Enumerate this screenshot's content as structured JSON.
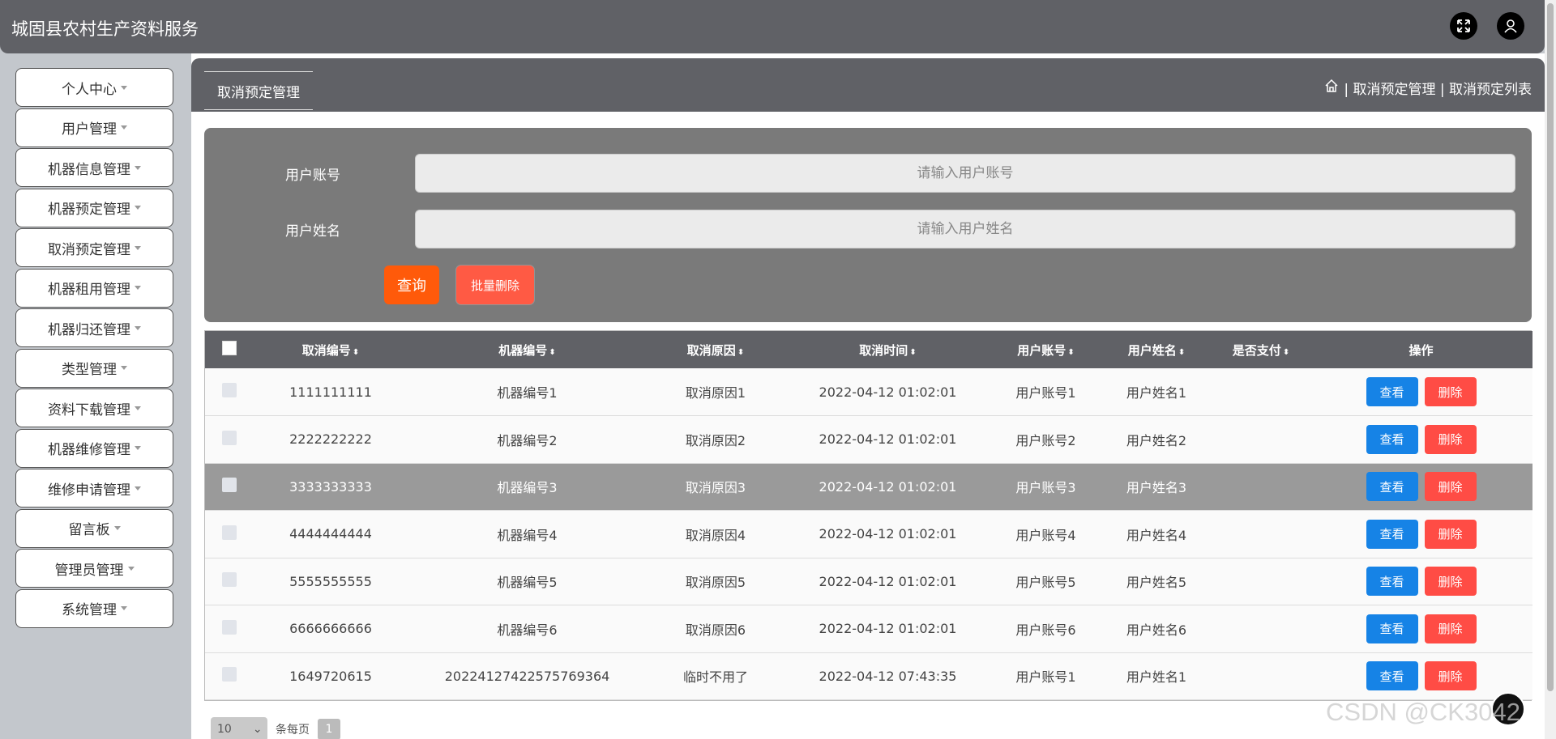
{
  "header": {
    "title": "城固县农村生产资料服务",
    "icons": [
      "fullscreen-icon",
      "user-icon"
    ]
  },
  "sidebar": {
    "items": [
      {
        "label": "个人中心"
      },
      {
        "label": "用户管理"
      },
      {
        "label": "机器信息管理"
      },
      {
        "label": "机器预定管理"
      },
      {
        "label": "取消预定管理"
      },
      {
        "label": "机器租用管理"
      },
      {
        "label": "机器归还管理"
      },
      {
        "label": "类型管理"
      },
      {
        "label": "资料下载管理"
      },
      {
        "label": "机器维修管理"
      },
      {
        "label": "维修申请管理"
      },
      {
        "label": "留言板"
      },
      {
        "label": "管理员管理"
      },
      {
        "label": "系统管理"
      }
    ]
  },
  "breadcrumb": {
    "page_title": "取消预定管理",
    "path": "| 取消预定管理 | 取消预定列表"
  },
  "search": {
    "account_label": "用户账号",
    "account_placeholder": "请输入用户账号",
    "name_label": "用户姓名",
    "name_placeholder": "请输入用户姓名",
    "query_label": "查询",
    "batch_delete_label": "批量删除"
  },
  "table": {
    "columns": [
      "取消编号",
      "机器编号",
      "取消原因",
      "取消时间",
      "用户账号",
      "用户姓名",
      "是否支付",
      "操作"
    ],
    "rows": [
      {
        "id": "1111111111",
        "machine": "机器编号1",
        "reason": "取消原因1",
        "time": "2022-04-12 01:02:01",
        "account": "用户账号1",
        "name": "用户姓名1",
        "paid": ""
      },
      {
        "id": "2222222222",
        "machine": "机器编号2",
        "reason": "取消原因2",
        "time": "2022-04-12 01:02:01",
        "account": "用户账号2",
        "name": "用户姓名2",
        "paid": ""
      },
      {
        "id": "3333333333",
        "machine": "机器编号3",
        "reason": "取消原因3",
        "time": "2022-04-12 01:02:01",
        "account": "用户账号3",
        "name": "用户姓名3",
        "paid": ""
      },
      {
        "id": "4444444444",
        "machine": "机器编号4",
        "reason": "取消原因4",
        "time": "2022-04-12 01:02:01",
        "account": "用户账号4",
        "name": "用户姓名4",
        "paid": ""
      },
      {
        "id": "5555555555",
        "machine": "机器编号5",
        "reason": "取消原因5",
        "time": "2022-04-12 01:02:01",
        "account": "用户账号5",
        "name": "用户姓名5",
        "paid": ""
      },
      {
        "id": "6666666666",
        "machine": "机器编号6",
        "reason": "取消原因6",
        "time": "2022-04-12 01:02:01",
        "account": "用户账号6",
        "name": "用户姓名6",
        "paid": ""
      },
      {
        "id": "1649720615",
        "machine": "20224127422575769364",
        "reason": "临时不用了",
        "time": "2022-04-12 07:43:35",
        "account": "用户账号1",
        "name": "用户姓名1",
        "paid": ""
      }
    ],
    "view_label": "查看",
    "delete_label": "删除"
  },
  "pager": {
    "page_size": "10",
    "per_page_label": "条每页",
    "current_page": "1"
  },
  "watermark": "CSDN @CK3042"
}
